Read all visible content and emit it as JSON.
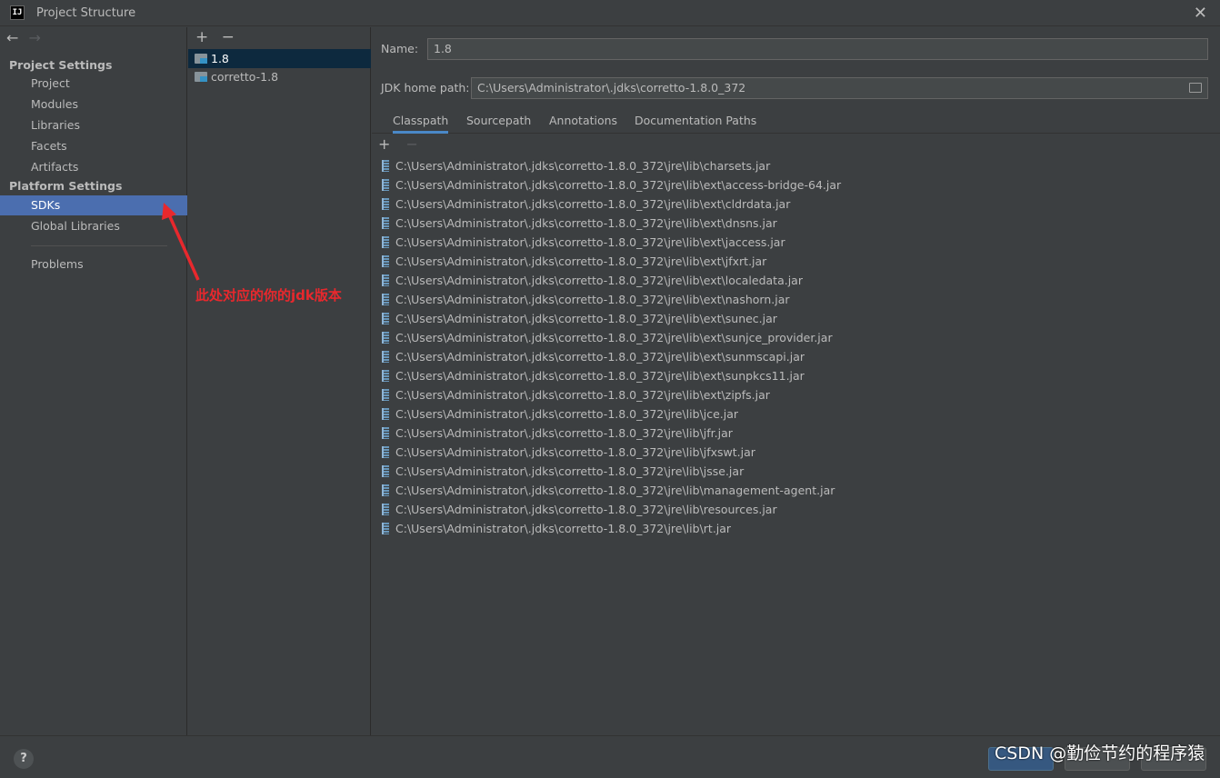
{
  "window": {
    "title": "Project Structure",
    "app_icon_text": "IJ"
  },
  "nav": {
    "back": "←",
    "forward": "→"
  },
  "sidebar": {
    "project_settings_title": "Project Settings",
    "project_items": [
      "Project",
      "Modules",
      "Libraries",
      "Facets",
      "Artifacts"
    ],
    "platform_settings_title": "Platform Settings",
    "platform_items": [
      "SDKs",
      "Global Libraries"
    ],
    "other_items": [
      "Problems"
    ],
    "selected": "SDKs"
  },
  "sdk_panel": {
    "add": "+",
    "remove": "−",
    "items": [
      "1.8",
      "corretto-1.8"
    ],
    "selected": "1.8"
  },
  "detail": {
    "name_label": "Name:",
    "name_value": "1.8",
    "home_label": "JDK home path:",
    "home_value": "C:\\Users\\Administrator\\.jdks\\corretto-1.8.0_372",
    "tabs": [
      "Classpath",
      "Sourcepath",
      "Annotations",
      "Documentation Paths"
    ],
    "active_tab": "Classpath",
    "list_add": "+",
    "list_remove": "−",
    "jars": [
      "C:\\Users\\Administrator\\.jdks\\corretto-1.8.0_372\\jre\\lib\\charsets.jar",
      "C:\\Users\\Administrator\\.jdks\\corretto-1.8.0_372\\jre\\lib\\ext\\access-bridge-64.jar",
      "C:\\Users\\Administrator\\.jdks\\corretto-1.8.0_372\\jre\\lib\\ext\\cldrdata.jar",
      "C:\\Users\\Administrator\\.jdks\\corretto-1.8.0_372\\jre\\lib\\ext\\dnsns.jar",
      "C:\\Users\\Administrator\\.jdks\\corretto-1.8.0_372\\jre\\lib\\ext\\jaccess.jar",
      "C:\\Users\\Administrator\\.jdks\\corretto-1.8.0_372\\jre\\lib\\ext\\jfxrt.jar",
      "C:\\Users\\Administrator\\.jdks\\corretto-1.8.0_372\\jre\\lib\\ext\\localedata.jar",
      "C:\\Users\\Administrator\\.jdks\\corretto-1.8.0_372\\jre\\lib\\ext\\nashorn.jar",
      "C:\\Users\\Administrator\\.jdks\\corretto-1.8.0_372\\jre\\lib\\ext\\sunec.jar",
      "C:\\Users\\Administrator\\.jdks\\corretto-1.8.0_372\\jre\\lib\\ext\\sunjce_provider.jar",
      "C:\\Users\\Administrator\\.jdks\\corretto-1.8.0_372\\jre\\lib\\ext\\sunmscapi.jar",
      "C:\\Users\\Administrator\\.jdks\\corretto-1.8.0_372\\jre\\lib\\ext\\sunpkcs11.jar",
      "C:\\Users\\Administrator\\.jdks\\corretto-1.8.0_372\\jre\\lib\\ext\\zipfs.jar",
      "C:\\Users\\Administrator\\.jdks\\corretto-1.8.0_372\\jre\\lib\\jce.jar",
      "C:\\Users\\Administrator\\.jdks\\corretto-1.8.0_372\\jre\\lib\\jfr.jar",
      "C:\\Users\\Administrator\\.jdks\\corretto-1.8.0_372\\jre\\lib\\jfxswt.jar",
      "C:\\Users\\Administrator\\.jdks\\corretto-1.8.0_372\\jre\\lib\\jsse.jar",
      "C:\\Users\\Administrator\\.jdks\\corretto-1.8.0_372\\jre\\lib\\management-agent.jar",
      "C:\\Users\\Administrator\\.jdks\\corretto-1.8.0_372\\jre\\lib\\resources.jar",
      "C:\\Users\\Administrator\\.jdks\\corretto-1.8.0_372\\jre\\lib\\rt.jar"
    ]
  },
  "annotation": {
    "text": "此处对应的你的jdk版本",
    "color": "#e8282d"
  },
  "footer": {
    "help": "?"
  },
  "watermark": "CSDN @勤俭节约的程序猿",
  "colors": {
    "selection": "#4b6eaf",
    "sdk_selection": "#0d293e",
    "tab_underline": "#4a88c7",
    "background": "#3c3f41"
  },
  "icons": {
    "sdk_item": "folder-sdk-icon",
    "jar": "jar-archive-icon",
    "browse": "folder-browse-icon"
  }
}
